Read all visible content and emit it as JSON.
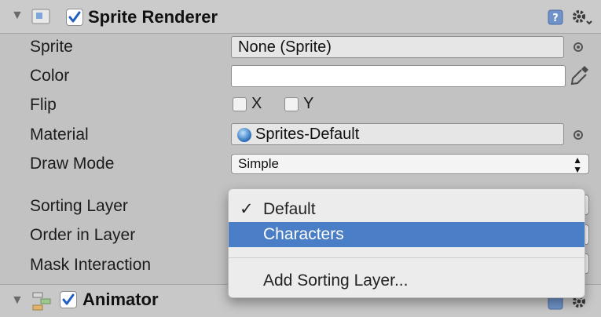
{
  "component": {
    "title": "Sprite Renderer",
    "enabled": true,
    "rows": {
      "sprite": {
        "label": "Sprite",
        "value": "None (Sprite)"
      },
      "color": {
        "label": "Color",
        "value": ""
      },
      "flip": {
        "label": "Flip",
        "x_label": "X",
        "y_label": "Y"
      },
      "material": {
        "label": "Material",
        "value": "Sprites-Default"
      },
      "draw_mode": {
        "label": "Draw Mode",
        "value": "Simple"
      },
      "sorting_layer": {
        "label": "Sorting Layer"
      },
      "order_in_layer": {
        "label": "Order in Layer"
      },
      "mask_interaction": {
        "label": "Mask Interaction"
      }
    }
  },
  "dropdown": {
    "check_glyph": "✓",
    "items": [
      {
        "label": "Default",
        "checked": true
      },
      {
        "label": "Characters",
        "highlighted": true
      }
    ],
    "add_label": "Add Sorting Layer..."
  },
  "animator": {
    "title": "Animator",
    "enabled": true
  },
  "colors": {
    "selection": "#4a7ec6",
    "panel": "#c2c2c2"
  }
}
